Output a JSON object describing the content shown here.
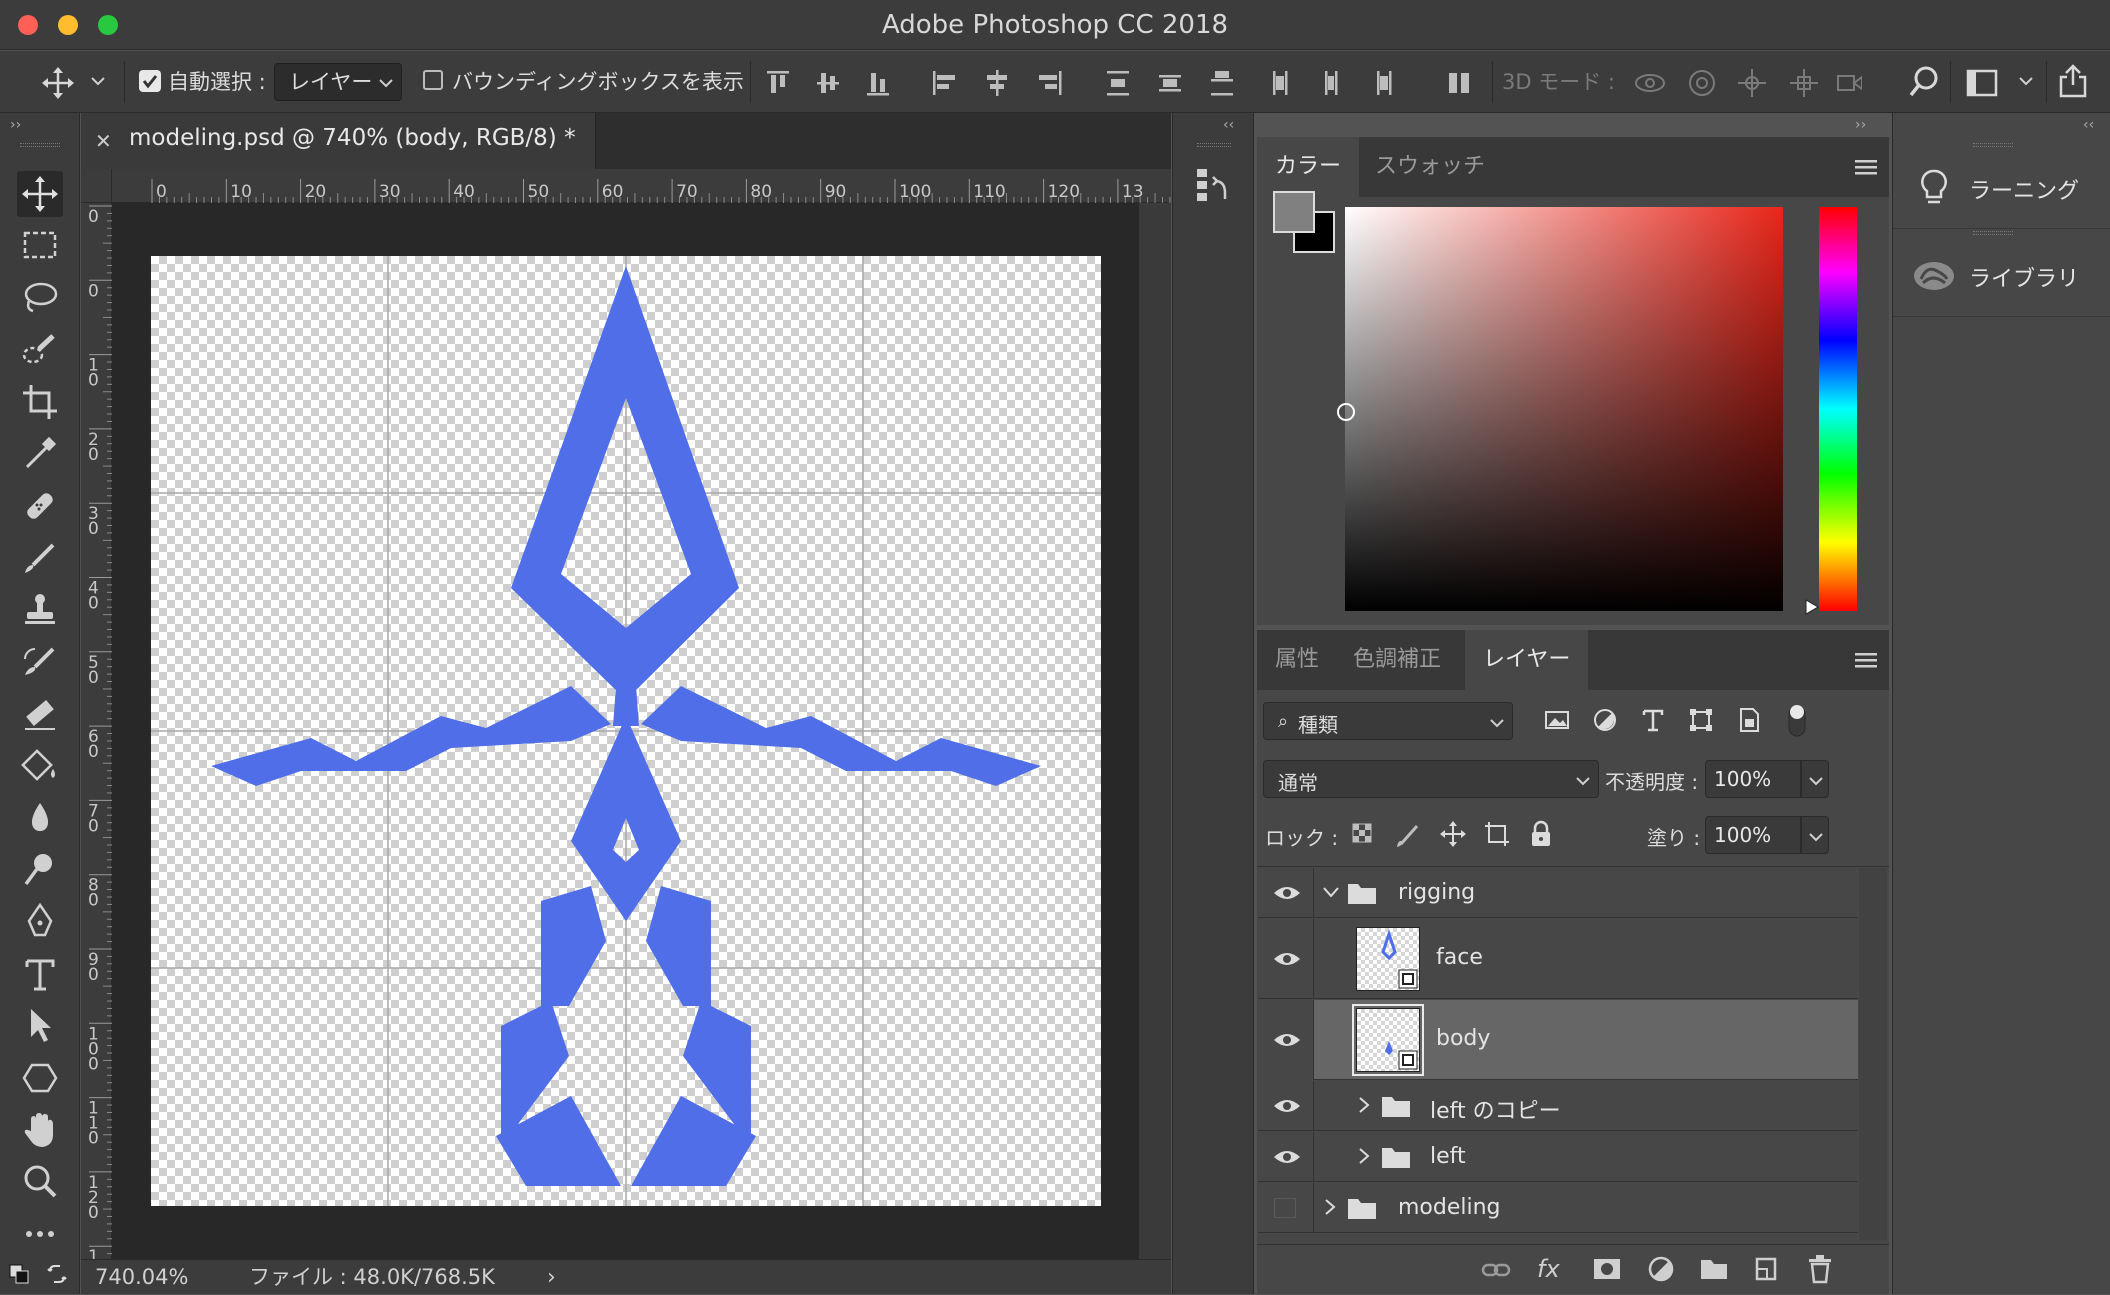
{
  "window": {
    "title": "Adobe Photoshop CC 2018"
  },
  "options_bar": {
    "auto_select_label": "自動選択 :",
    "auto_select_checked": true,
    "auto_select_target": "レイヤー",
    "bounding_box_label": "バウンディングボックスを表示",
    "bounding_box_checked": false,
    "mode_3d_label": "3D モード :"
  },
  "document": {
    "tab_title": "modeling.psd @ 740% (body, RGB/8) *",
    "ruler_top_labels": [
      "0",
      "10",
      "20",
      "30",
      "40",
      "50",
      "60",
      "70",
      "80",
      "90",
      "100",
      "110",
      "120",
      "13"
    ],
    "ruler_left_labels": [
      "0",
      "0",
      "1\n0",
      "2\n0",
      "3\n0",
      "4\n0",
      "5\n0",
      "6\n0",
      "7\n0",
      "8\n0",
      "9\n0",
      "1\n0\n0",
      "1\n1\n0",
      "1\n2\n0",
      "1\n3"
    ],
    "zoom": "740.04%",
    "file_info": "ファイル : 48.0K/768.5K",
    "shape_color": "#4f6ee8"
  },
  "color_panel": {
    "tabs": [
      "カラー",
      "スウォッチ"
    ],
    "active_tab": "カラー",
    "foreground_color": "#808080",
    "background_color": "#000000",
    "hue_color": "#e8261a"
  },
  "layers_panel": {
    "tabs": [
      "属性",
      "色調補正",
      "レイヤー"
    ],
    "active_tab": "レイヤー",
    "filter_kind": "種類",
    "blend_mode": "通常",
    "opacity_label": "不透明度 :",
    "opacity_value": "100%",
    "lock_label": "ロック :",
    "fill_label": "塗り :",
    "fill_value": "100%",
    "layers": [
      {
        "name": "rigging",
        "type": "group",
        "visible": true,
        "expanded": true,
        "indent": 0
      },
      {
        "name": "face",
        "type": "smart",
        "visible": true,
        "indent": 1
      },
      {
        "name": "body",
        "type": "smart",
        "visible": true,
        "selected": true,
        "indent": 1
      },
      {
        "name": "left のコピー",
        "type": "group",
        "visible": true,
        "indent": 1
      },
      {
        "name": "left",
        "type": "group",
        "visible": true,
        "indent": 1
      },
      {
        "name": "modeling",
        "type": "group",
        "visible": false,
        "indent": 0
      }
    ]
  },
  "right_panel": {
    "items": [
      {
        "label": "ラーニング",
        "icon": "lightbulb-icon"
      },
      {
        "label": "ライブラリ",
        "icon": "libraries-icon"
      }
    ]
  }
}
